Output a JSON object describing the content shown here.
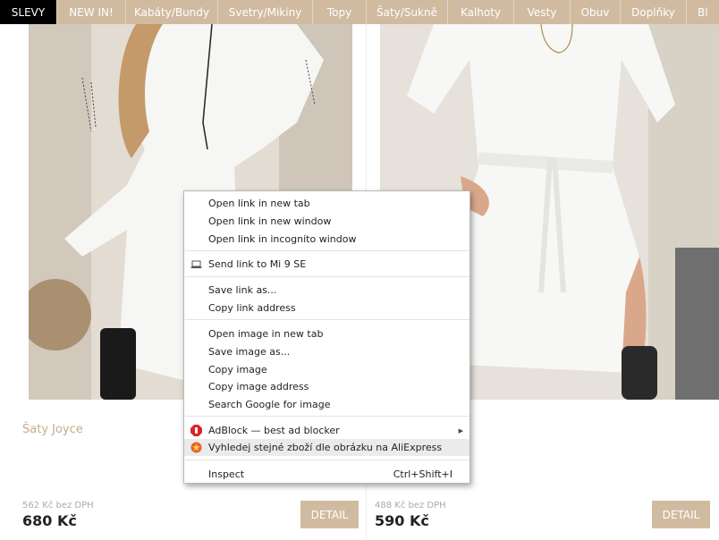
{
  "nav": {
    "items": [
      {
        "label": "SLEVY",
        "active": true
      },
      {
        "label": "NEW IN!"
      },
      {
        "label": "Kabáty/Bundy"
      },
      {
        "label": "Svetry/Mikiny"
      },
      {
        "label": "Topy"
      },
      {
        "label": "Šaty/Sukně"
      },
      {
        "label": "Kalhoty"
      },
      {
        "label": "Vesty"
      },
      {
        "label": "Obuv"
      },
      {
        "label": "Doplňky"
      },
      {
        "label": "Bl"
      }
    ]
  },
  "products": [
    {
      "name": "Šaty Joyce",
      "net_price": "562 Kč bez DPH",
      "price": "680 Kč",
      "button": "DETAIL"
    },
    {
      "name": "",
      "net_price": "488 Kč bez DPH",
      "price": "590 Kč",
      "button": "DETAIL"
    }
  ],
  "context_menu": {
    "open_new_tab": "Open link in new tab",
    "open_new_window": "Open link in new window",
    "open_incognito": "Open link in incognito window",
    "send_link": "Send link to Mi 9 SE",
    "save_link": "Save link as...",
    "copy_link": "Copy link address",
    "open_image": "Open image in new tab",
    "save_image": "Save image as...",
    "copy_image": "Copy image",
    "copy_image_address": "Copy image address",
    "search_google": "Search Google for image",
    "adblock": "AdBlock — best ad blocker",
    "aliexpress": "Vyhledej stejné zboží dle obrázku na AliExpress",
    "inspect": "Inspect",
    "inspect_shortcut": "Ctrl+Shift+I"
  },
  "colors": {
    "accent": "#d1bba0",
    "active_nav": "#000000",
    "product_name": "#c8a98a"
  }
}
